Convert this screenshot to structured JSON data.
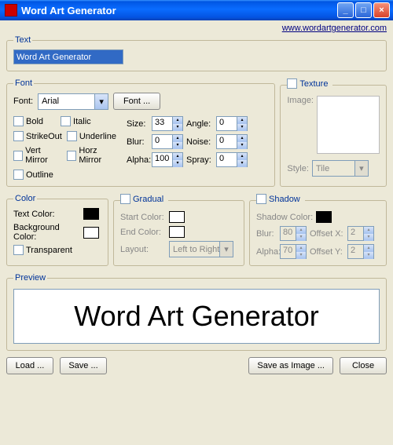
{
  "window": {
    "title": "Word Art Generator"
  },
  "link": "www.wordartgenerator.com",
  "groups": {
    "text": "Text",
    "font": "Font",
    "texture": "Texture",
    "color": "Color",
    "gradual": "Gradual",
    "shadow": "Shadow",
    "preview": "Preview"
  },
  "text": {
    "value": "Word Art Generator"
  },
  "font": {
    "label": "Font:",
    "name": "Arial",
    "button": "Font ...",
    "chk": {
      "bold": "Bold",
      "italic": "Italic",
      "strikeout": "StrikeOut",
      "underline": "Underline",
      "vertmirror": "Vert Mirror",
      "horzmirror": "Horz Mirror",
      "outline": "Outline"
    },
    "size_label": "Size:",
    "size": "33",
    "angle_label": "Angle:",
    "angle": "0",
    "blur_label": "Blur:",
    "blur": "0",
    "noise_label": "Noise:",
    "noise": "0",
    "alpha_label": "Alpha:",
    "alpha": "100",
    "spray_label": "Spray:",
    "spray": "0"
  },
  "texture": {
    "image_label": "Image:",
    "style_label": "Style:",
    "style": "Tile"
  },
  "color": {
    "textcolor_label": "Text Color:",
    "textcolor": "#000000",
    "bgcolor_label": "Background Color:",
    "bgcolor": "#ffffff",
    "transparent": "Transparent"
  },
  "gradual": {
    "start_label": "Start Color:",
    "end_label": "End Color:",
    "layout_label": "Layout:",
    "layout": "Left to Right"
  },
  "shadow": {
    "color_label": "Shadow Color:",
    "color": "#000000",
    "blur_label": "Blur:",
    "blur": "80",
    "offsetx_label": "Offset X:",
    "offsetx": "2",
    "alpha_label": "Alpha:",
    "alpha": "70",
    "offsety_label": "Offset Y:",
    "offsety": "2"
  },
  "preview": {
    "text": "Word Art Generator"
  },
  "buttons": {
    "load": "Load ...",
    "save": "Save ...",
    "save_image": "Save as Image ...",
    "close": "Close"
  }
}
